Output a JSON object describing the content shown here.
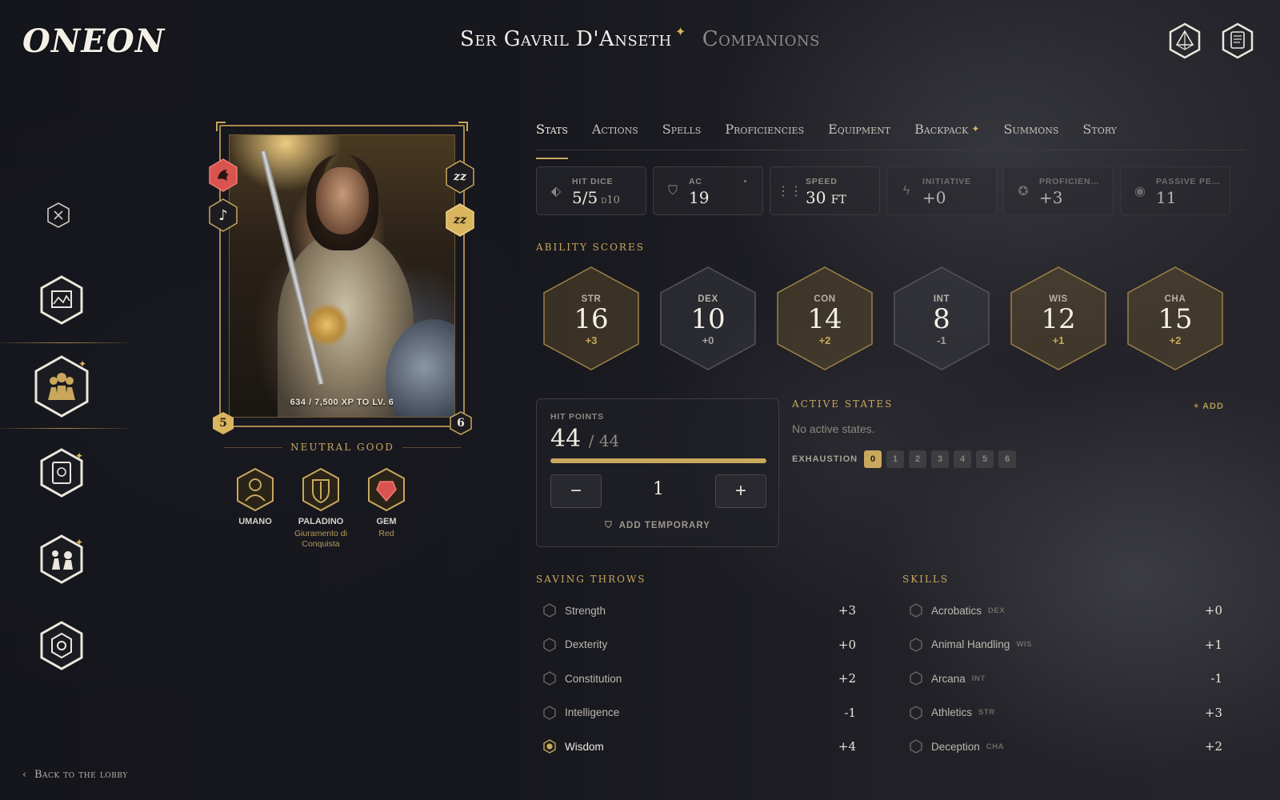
{
  "app": {
    "logo": "ONEON"
  },
  "header": {
    "character_name": "Ser Gavril D'Anseth",
    "companions_label": "Companions"
  },
  "footer": {
    "back_label": "Back to the lobby"
  },
  "portrait": {
    "xp_text": "634 / 7,500 XP TO LV. 6",
    "level": "5",
    "next_level": "6",
    "sleep_icon": "zz"
  },
  "alignment": "NEUTRAL GOOD",
  "traits": [
    {
      "name": "UMANO",
      "sub": ""
    },
    {
      "name": "PALADINO",
      "sub": "Giuramento di Conquista"
    },
    {
      "name": "GEM",
      "sub": "Red"
    }
  ],
  "tabs": [
    {
      "label": "Stats",
      "spark": ""
    },
    {
      "label": "Actions",
      "spark": ""
    },
    {
      "label": "Spells",
      "spark": ""
    },
    {
      "label": "Proficiencies",
      "spark": ""
    },
    {
      "label": "Equipment",
      "spark": ""
    },
    {
      "label": "Backpack",
      "spark": "✦"
    },
    {
      "label": "Summons",
      "spark": ""
    },
    {
      "label": "Story",
      "spark": ""
    }
  ],
  "stat_cards": [
    {
      "label": "HIT DICE",
      "value": "5/5",
      "unit": "d10"
    },
    {
      "label": "AC",
      "value": "19",
      "unit": ""
    },
    {
      "label": "SPEED",
      "value": "30 ft",
      "unit": ""
    },
    {
      "label": "INITIATIVE",
      "value": "+0",
      "unit": ""
    },
    {
      "label": "PROFICIEN…",
      "value": "+3",
      "unit": ""
    },
    {
      "label": "PASSIVE PE…",
      "value": "11",
      "unit": ""
    }
  ],
  "ability_scores": {
    "title": "ABILITY SCORES",
    "items": [
      {
        "abbr": "STR",
        "score": "16",
        "mod": "+3"
      },
      {
        "abbr": "DEX",
        "score": "10",
        "mod": "+0"
      },
      {
        "abbr": "CON",
        "score": "14",
        "mod": "+2"
      },
      {
        "abbr": "INT",
        "score": "8",
        "mod": "-1"
      },
      {
        "abbr": "WIS",
        "score": "12",
        "mod": "+1"
      },
      {
        "abbr": "CHA",
        "score": "15",
        "mod": "+2"
      }
    ]
  },
  "hit_points": {
    "label": "HIT POINTS",
    "current": "44",
    "max": "/ 44",
    "fill_fraction": 1.0,
    "minus": "−",
    "plus": "+",
    "amount": "1",
    "add_temp_label": "ADD TEMPORARY"
  },
  "active_states": {
    "title": "ACTIVE STATES",
    "add_label": "+ ADD",
    "empty_text": "No active states.",
    "exhaustion_label": "EXHAUSTION",
    "exhaustion_levels": [
      "0",
      "1",
      "2",
      "3",
      "4",
      "5",
      "6"
    ],
    "exhaustion_current": 0
  },
  "saving_throws": {
    "title": "SAVING THROWS",
    "rows": [
      {
        "name": "Strength",
        "bonus": "+3"
      },
      {
        "name": "Dexterity",
        "bonus": "+0"
      },
      {
        "name": "Constitution",
        "bonus": "+2"
      },
      {
        "name": "Intelligence",
        "bonus": "-1"
      },
      {
        "name": "Wisdom",
        "bonus": "+4"
      }
    ]
  },
  "skills": {
    "title": "SKILLS",
    "rows": [
      {
        "name": "Acrobatics",
        "ability": "DEX",
        "bonus": "+0"
      },
      {
        "name": "Animal Handling",
        "ability": "WIS",
        "bonus": "+1"
      },
      {
        "name": "Arcana",
        "ability": "INT",
        "bonus": "-1"
      },
      {
        "name": "Athletics",
        "ability": "STR",
        "bonus": "+3"
      },
      {
        "name": "Deception",
        "ability": "CHA",
        "bonus": "+2"
      }
    ]
  },
  "colors": {
    "gold": "#c9a85c",
    "background": "#15151c",
    "danger": "#d9534f"
  }
}
